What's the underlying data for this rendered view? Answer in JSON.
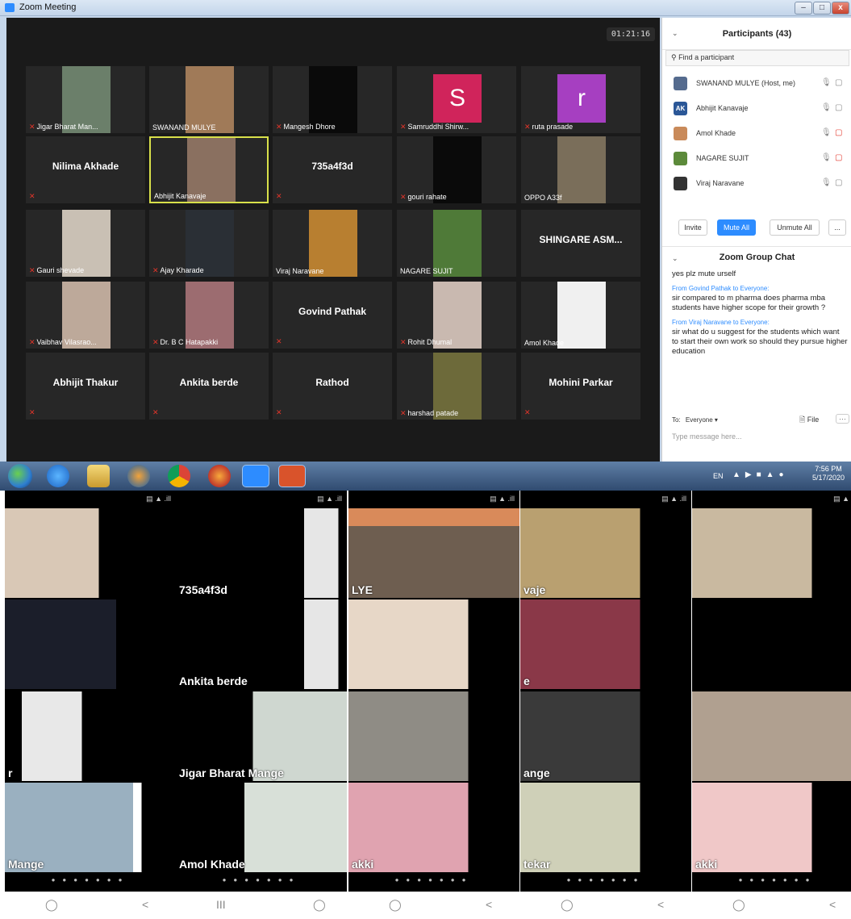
{
  "window": {
    "title": "Zoom Meeting",
    "min": "–",
    "max": "□",
    "close": "x"
  },
  "meeting": {
    "timer": "01:21:16"
  },
  "tiles": [
    {
      "name": "Jigar Bharat Man...",
      "muted": true
    },
    {
      "name": "SWANAND MULYE",
      "muted": false
    },
    {
      "name": "Mangesh Dhore",
      "muted": true
    },
    {
      "name": "Samruddhi Shirw...",
      "muted": true,
      "initial": "S",
      "color": "#d0245b"
    },
    {
      "name": "ruta prasade",
      "muted": true,
      "initial": "r",
      "color": "#a63fc1"
    },
    {
      "name": "Nilima Akhade",
      "big": true,
      "muted": true
    },
    {
      "name": "Abhijit Kanavaje",
      "muted": false,
      "active": true
    },
    {
      "name": "735a4f3d",
      "big": true,
      "muted": true
    },
    {
      "name": "gouri rahate",
      "muted": true
    },
    {
      "name": "OPPO A33f",
      "muted": false
    },
    {
      "name": "Gauri shevade",
      "muted": true
    },
    {
      "name": "Ajay Kharade",
      "muted": true
    },
    {
      "name": "Viraj Naravane",
      "muted": false
    },
    {
      "name": "NAGARE SUJIT",
      "muted": false
    },
    {
      "name": "SHINGARE ASM...",
      "big": true,
      "muted": false
    },
    {
      "name": "Vaibhav Vilasrao...",
      "muted": true
    },
    {
      "name": "Dr. B C Hatapakki",
      "muted": true
    },
    {
      "name": "Govind Pathak",
      "big": true,
      "muted": true
    },
    {
      "name": "Rohit Dhumal",
      "muted": true
    },
    {
      "name": "Amol Khade",
      "muted": false
    },
    {
      "name": "Abhijit Thakur",
      "big": true,
      "muted": true
    },
    {
      "name": "Ankita berde",
      "big": true,
      "muted": true
    },
    {
      "name": "Rathod",
      "big": true,
      "muted": true
    },
    {
      "name": "harshad patade",
      "muted": true
    },
    {
      "name": "Mohini Parkar",
      "big": true,
      "muted": true
    }
  ],
  "participants": {
    "title": "Participants (43)",
    "search_placeholder": "Find a participant",
    "list": [
      {
        "name": "SWANAND MULYE (Host, me)",
        "avatar": "",
        "color": "#556b8e",
        "cam_off": false
      },
      {
        "name": "Abhijit Kanavaje",
        "avatar": "AK",
        "color": "#2b5797",
        "cam_off": false
      },
      {
        "name": "Amol Khade",
        "avatar": "",
        "color": "#c98a5a",
        "cam_off": true
      },
      {
        "name": "NAGARE SUJIT",
        "avatar": "",
        "color": "#5c8a3a",
        "cam_off": true
      },
      {
        "name": "Viraj Naravane",
        "avatar": "",
        "color": "#333333",
        "cam_off": false
      }
    ],
    "invite": "Invite",
    "mute_all": "Mute All",
    "unmute_all": "Unmute All",
    "more": "..."
  },
  "chat": {
    "title": "Zoom Group Chat",
    "messages": [
      {
        "from": "",
        "text": "yes plz mute urself"
      },
      {
        "from": "From Govind Pathak to Everyone:",
        "text": "sir compared to m pharma does pharma mba students have higher scope for their growth ?"
      },
      {
        "from": "From Viraj Naravane to Everyone:",
        "text": "sir what do u suggest for the students which want to start their own work so should they pursue higher education"
      }
    ],
    "to_label": "To:",
    "to_value": "Everyone",
    "file_label": "File",
    "more": "···",
    "placeholder": "Type message here..."
  },
  "taskbar": {
    "lang": "EN",
    "time": "7:56 PM",
    "date": "5/17/2020"
  },
  "phones": [
    {
      "labels": [
        "",
        "",
        "r",
        "Mange"
      ]
    },
    {
      "labels": [
        "735a4f3d",
        "Ankita berde",
        "Jigar Bharat Mange",
        "Amol Khade"
      ]
    },
    {
      "labels": [
        "LYE",
        "",
        "",
        "akki"
      ]
    },
    {
      "labels": [
        "vaje",
        "e",
        "ange",
        "tekar"
      ]
    },
    {
      "labels": [
        "",
        "",
        "",
        "akki"
      ]
    }
  ],
  "colors": {
    "accent": "#2d8cff",
    "muted": "#e2352a",
    "active_border": "#d8e04a"
  }
}
